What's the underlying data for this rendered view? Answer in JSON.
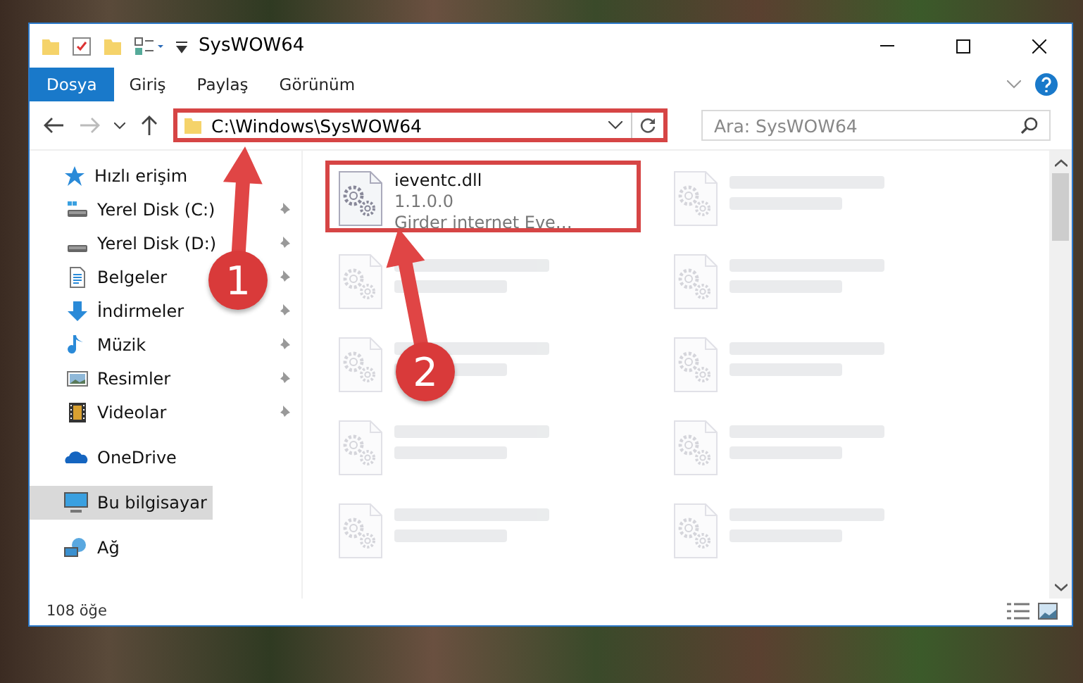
{
  "window": {
    "title": "SysWOW64"
  },
  "ribbon_tabs": [
    {
      "label": "Dosya",
      "selected": true
    },
    {
      "label": "Giriş",
      "selected": false
    },
    {
      "label": "Paylaş",
      "selected": false
    },
    {
      "label": "Görünüm",
      "selected": false
    }
  ],
  "address_bar": {
    "path": "C:\\Windows\\SysWOW64",
    "highlighted": true
  },
  "search": {
    "placeholder": "Ara: SysWOW64"
  },
  "sidebar": {
    "items": [
      {
        "label": "Hızlı erişim",
        "kind": "star",
        "selected": false,
        "children": [
          {
            "label": "Yerel Disk (C:)",
            "kind": "drive-c",
            "pinned": true
          },
          {
            "label": "Yerel Disk (D:)",
            "kind": "drive",
            "pinned": true
          },
          {
            "label": "Belgeler",
            "kind": "documents",
            "pinned": true
          },
          {
            "label": "İndirmeler",
            "kind": "downloads",
            "pinned": true
          },
          {
            "label": "Müzik",
            "kind": "music",
            "pinned": true
          },
          {
            "label": "Resimler",
            "kind": "pictures",
            "pinned": true
          },
          {
            "label": "Videolar",
            "kind": "videos",
            "pinned": true
          }
        ]
      },
      {
        "label": "OneDrive",
        "kind": "cloud",
        "selected": false
      },
      {
        "label": "Bu bilgisayar",
        "kind": "computer",
        "selected": true
      },
      {
        "label": "Ağ",
        "kind": "network",
        "selected": false
      }
    ]
  },
  "files": [
    {
      "name": "ieventc.dll",
      "line_2": "1.1.0.0",
      "line_3": "Girder internet Eve…",
      "highlighted": true,
      "blurred": false
    },
    {
      "highlighted": false,
      "blurred": true
    },
    {
      "highlighted": false,
      "blurred": true
    },
    {
      "highlighted": false,
      "blurred": true
    },
    {
      "highlighted": false,
      "blurred": true
    },
    {
      "highlighted": false,
      "blurred": true
    },
    {
      "highlighted": false,
      "blurred": true
    },
    {
      "highlighted": false,
      "blurred": true
    },
    {
      "highlighted": false,
      "blurred": true
    },
    {
      "highlighted": false,
      "blurred": true
    }
  ],
  "status_bar": {
    "item_count": "108 öğe"
  },
  "callouts": [
    {
      "label": "1"
    },
    {
      "label": "2"
    }
  ]
}
